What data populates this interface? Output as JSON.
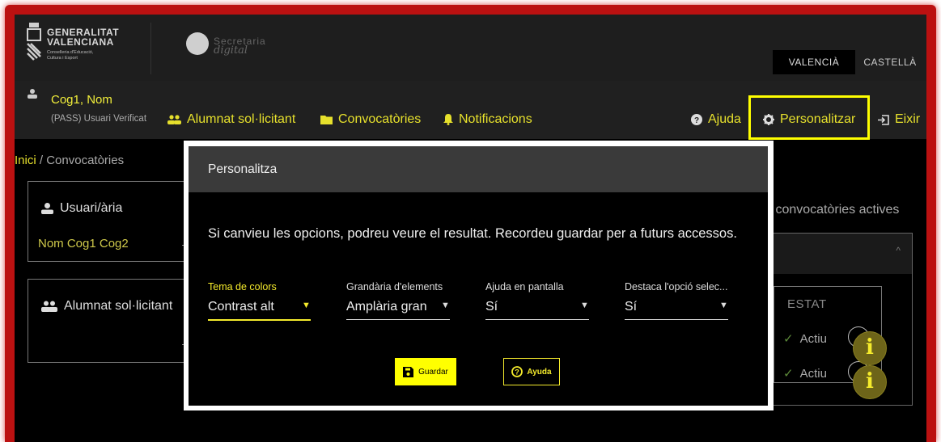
{
  "header": {
    "gva_line1": "GENERALITAT",
    "gva_line2": "VALENCIANA",
    "gva_sub1": "Conselleria d'Educació,",
    "gva_sub2": "Cultura i Esport",
    "sd_line1": "Secretaria",
    "sd_line2": "digital",
    "lang_valencia": "VALENCIÀ",
    "lang_castella": "CASTELLÀ"
  },
  "nav": {
    "user_name": "Cog1, Nom",
    "user_sub": "(PASS) Usuari Verificat",
    "alumnat": "Alumnat sol·licitant",
    "convocatories": "Convocatòries",
    "notificacions": "Notificacions",
    "ajuda": "Ajuda",
    "personalitzar": "Personalitzar",
    "eixir": "Eixir"
  },
  "breadcrumb": {
    "home": "Inici",
    "sep": " / ",
    "current": "Convocatòries"
  },
  "cards": {
    "usuari_title": "Usuari/ària",
    "usuari_value": "Nom Cog1 Cog2",
    "alumnat_title": "Alumnat sol·licitant",
    "arrow": "→"
  },
  "right_panel": {
    "title": "s convocatòries actives",
    "estat_header": "ESTAT",
    "rows": [
      "Actiu",
      "Actiu"
    ],
    "info_glyph": "i"
  },
  "modal": {
    "title": "Personalitza",
    "message": "Si canvieu les opcions, podreu veure el resultat. Recordeu guardar per a futurs accessos.",
    "selects": [
      {
        "label": "Tema de colors",
        "value": "Contrast alt"
      },
      {
        "label": "Grandària d'elements",
        "value": "Amplària gran"
      },
      {
        "label": "Ajuda en pantalla",
        "value": "Sí"
      },
      {
        "label": "Destaca l'opció selec...",
        "value": "Sí"
      }
    ],
    "save_label": "Guardar",
    "help_label": "Ayuda"
  },
  "colors": {
    "accent": "#f5eb2c",
    "highlight": "#ffff00",
    "frame": "#bb1111",
    "background": "#000000"
  }
}
